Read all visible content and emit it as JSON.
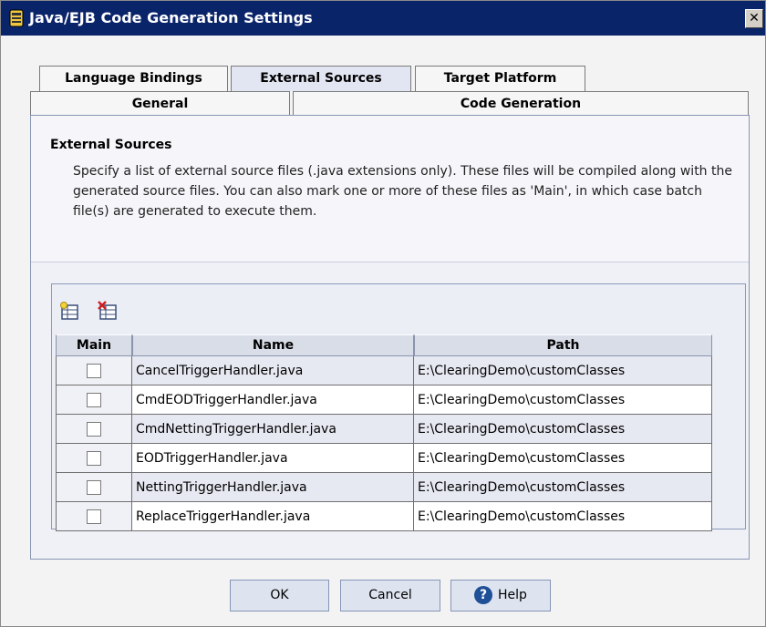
{
  "window": {
    "title": "Java/EJB Code Generation Settings",
    "close_label": "✕"
  },
  "tabs": {
    "row1": [
      {
        "label": "Language Bindings"
      },
      {
        "label": "External Sources"
      },
      {
        "label": "Target Platform"
      }
    ],
    "row2": [
      {
        "label": "General"
      },
      {
        "label": "Code Generation"
      }
    ],
    "active": "External Sources"
  },
  "section": {
    "title": "External Sources",
    "description": "Specify a list of external source files (.java extensions only). These files will be compiled along with the generated source files. You can also mark one or more of these files as 'Main', in which case batch file(s) are generated to execute them."
  },
  "toolbar": {
    "add_icon": "add-row-icon",
    "delete_icon": "delete-row-icon"
  },
  "table": {
    "columns": [
      "Main",
      "Name",
      "Path"
    ],
    "rows": [
      {
        "main": false,
        "name": "CancelTriggerHandler.java",
        "path": "E:\\ClearingDemo\\customClasses"
      },
      {
        "main": false,
        "name": "CmdEODTriggerHandler.java",
        "path": "E:\\ClearingDemo\\customClasses"
      },
      {
        "main": false,
        "name": "CmdNettingTriggerHandler.java",
        "path": "E:\\ClearingDemo\\customClasses"
      },
      {
        "main": false,
        "name": "EODTriggerHandler.java",
        "path": "E:\\ClearingDemo\\customClasses"
      },
      {
        "main": false,
        "name": "NettingTriggerHandler.java",
        "path": "E:\\ClearingDemo\\customClasses"
      },
      {
        "main": false,
        "name": "ReplaceTriggerHandler.java",
        "path": "E:\\ClearingDemo\\customClasses"
      }
    ]
  },
  "buttons": {
    "ok": "OK",
    "cancel": "Cancel",
    "help": "Help"
  },
  "colors": {
    "titlebar": "#0a246a",
    "accent": "#1f4f96"
  }
}
